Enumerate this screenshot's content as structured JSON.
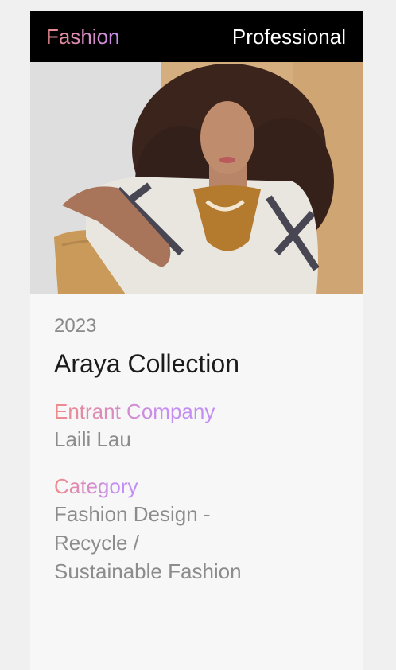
{
  "header": {
    "left_label": "Fashion",
    "right_label": "Professional"
  },
  "entry": {
    "year": "2023",
    "title": "Araya Collection",
    "company_label": "Entrant Company",
    "company_value": "Laili Lau",
    "category_label": "Category",
    "category_value": "Fashion Design - Recycle / Sustainable Fashion"
  },
  "colors": {
    "header_bg": "#000000",
    "gradient_start": "#e98a8a",
    "gradient_end": "#c08ff4",
    "card_bg": "#f7f7f7"
  }
}
